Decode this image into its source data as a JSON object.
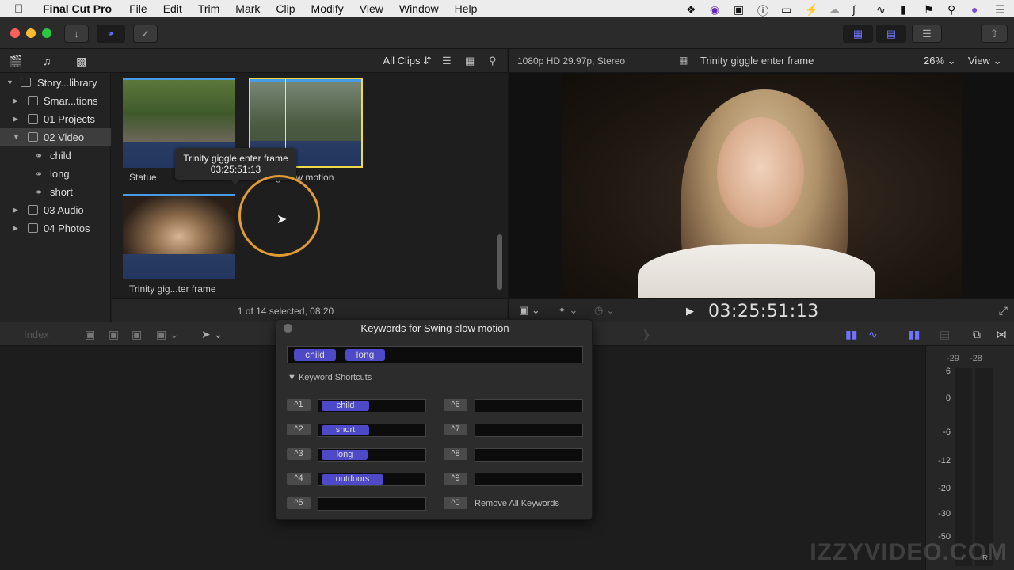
{
  "menubar": {
    "app_name": "Final Cut Pro",
    "items": [
      "File",
      "Edit",
      "Trim",
      "Mark",
      "Clip",
      "Modify",
      "View",
      "Window",
      "Help"
    ]
  },
  "browser": {
    "filter": "All Clips",
    "status": "1 of 14 selected, 08:20",
    "clips": [
      {
        "name": "Statue"
      },
      {
        "name": "Swing slow motion"
      },
      {
        "name": "Trinity gig...ter frame"
      }
    ],
    "tooltip": {
      "title": "Trinity giggle enter frame",
      "timecode": "03:25:51:13"
    }
  },
  "sidebar": {
    "items": [
      {
        "label": "Story...library"
      },
      {
        "label": "Smar...tions"
      },
      {
        "label": "01 Projects"
      },
      {
        "label": "02 Video"
      },
      {
        "label": "child"
      },
      {
        "label": "long"
      },
      {
        "label": "short"
      },
      {
        "label": "03 Audio"
      },
      {
        "label": "04 Photos"
      }
    ]
  },
  "viewer": {
    "format": "1080p HD 29.97p, Stereo",
    "clip_title": "Trinity giggle enter frame",
    "zoom": "26%",
    "view_label": "View",
    "timecode": "03:25:51:13"
  },
  "timeline": {
    "index_label": "Index"
  },
  "meters": {
    "peaks": [
      "-29",
      "-28"
    ],
    "scale": [
      "6",
      "0",
      "-6",
      "-12",
      "-20",
      "-30",
      "-50"
    ],
    "channels": [
      "L",
      "R"
    ]
  },
  "keyword_hud": {
    "title": "Keywords for Swing slow motion",
    "applied": [
      "child",
      "long"
    ],
    "section_label": "Keyword Shortcuts",
    "shortcuts": [
      {
        "key": "^1",
        "keyword": "child"
      },
      {
        "key": "^2",
        "keyword": "short"
      },
      {
        "key": "^3",
        "keyword": "long"
      },
      {
        "key": "^4",
        "keyword": "outdoors"
      },
      {
        "key": "^5",
        "keyword": ""
      },
      {
        "key": "^6",
        "keyword": ""
      },
      {
        "key": "^7",
        "keyword": ""
      },
      {
        "key": "^8",
        "keyword": ""
      },
      {
        "key": "^9",
        "keyword": ""
      },
      {
        "key": "^0",
        "keyword": ""
      }
    ],
    "remove_all_label": "Remove All Keywords"
  },
  "watermark": "IZZYVIDEO.COM",
  "colors": {
    "accent": "#6f74ff",
    "keyword_token": "#4e4ac7",
    "selection_border": "#f0d94a",
    "ring": "#e29a35"
  }
}
